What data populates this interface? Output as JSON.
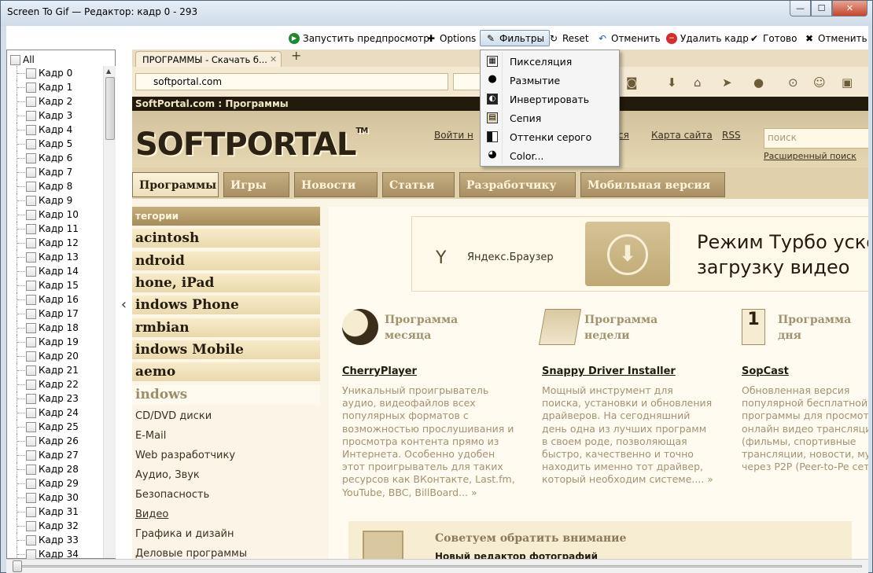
{
  "window": {
    "title": "Screen To Gif — Редактор: кадр 0 - 293",
    "min": "—",
    "max": "☐",
    "close": "✕"
  },
  "toolbar": {
    "preview": "Запустить предпросмотр",
    "options": "Options",
    "filters": "Фильтры",
    "reset": "Reset",
    "undo": "Отменить",
    "delete_frame": "Удалить кадр",
    "done": "Готово",
    "cancel": "Отменить"
  },
  "filters_menu": {
    "items": [
      "Пикселяция",
      "Размытие",
      "Инвертировать",
      "Сепия",
      "Оттенки серого",
      "Color..."
    ]
  },
  "frames": {
    "all_label": "All",
    "items": [
      "Кадр 0",
      "Кадр 1",
      "Кадр 2",
      "Кадр 3",
      "Кадр 4",
      "Кадр 5",
      "Кадр 6",
      "Кадр 7",
      "Кадр 8",
      "Кадр 9",
      "Кадр 10",
      "Кадр 11",
      "Кадр 12",
      "Кадр 13",
      "Кадр 14",
      "Кадр 15",
      "Кадр 16",
      "Кадр 17",
      "Кадр 18",
      "Кадр 19",
      "Кадр 20",
      "Кадр 21",
      "Кадр 22",
      "Кадр 23",
      "Кадр 24",
      "Кадр 25",
      "Кадр 26",
      "Кадр 27",
      "Кадр 28",
      "Кадр 29",
      "Кадр 30",
      "Кадр 31",
      "Кадр 32",
      "Кадр 33",
      "Кадр 34"
    ]
  },
  "preview": {
    "tab_title": "ПРОГРАММЫ - Скачать б...",
    "tab_close": "✕",
    "tab_new": "+",
    "url": "softportal.com",
    "site_bar": "SoftPortal.com : Программы",
    "logo": "SOFTPORTAL",
    "logo_tm": "TM",
    "header_links": [
      "Войти н",
      "ся",
      "Карта сайта",
      "RSS"
    ],
    "search_placeholder": "поиск",
    "adv_search": "Расширенный поиск",
    "nav": [
      "Программы",
      "Игры",
      "Новости",
      "Статьи",
      "Разработчику",
      "Мобильная версия"
    ],
    "categories_head": "тегории",
    "categories_big": [
      "acintosh",
      "ndroid",
      "hone, iPad",
      "indows Phone",
      "rmbian",
      "indows Mobile",
      "aemo",
      "indows"
    ],
    "categories_small": [
      "CD/DVD диски",
      "E-Mail",
      "Web разработчику",
      "Аудио, Звук",
      "Безопасность",
      "Видео",
      "Графика и дизайн",
      "Деловые программы"
    ],
    "banner": {
      "ytext": "Яндекс.Браузер",
      "line1": "Режим Турбо ускор",
      "line2": "загрузку видео"
    },
    "programs": [
      {
        "head1": "Программа",
        "head2": "месяца",
        "name": "CherryPlayer",
        "desc": "Уникальный проигрыватель аудио, видеофайлов всех популярных форматов с возможностью прослушивания и просмотра контента прямо из Интернета. Особенно удобен этот проигрыватель для таких ресурсов как ВКонтакте, Last.fm, YouTube, BBC, BillBoard... »"
      },
      {
        "head1": "Программа",
        "head2": "недели",
        "name": "Snappy Driver Installer",
        "desc": "Мощный инструмент для поиска, установки и обновления драйверов. На сегодняшний день одна из лучших программ в своем роде, позволяющая быстро, качественно и точно находить именно тот драйвер, который необходим системе.... »"
      },
      {
        "head1": "Программа",
        "head2": "дня",
        "name": "SopCast",
        "desc": "Обновленная версия популярной бесплатной программы для просмотр онлайн видео трансляций (фильмы, спортивные трансляции, новости, му т.д.) через P2P (Peer-to-Pe сети... »"
      }
    ],
    "advice_title": "Советуем обратить внимание",
    "advice_sub": "Новый редактор фотографий"
  }
}
